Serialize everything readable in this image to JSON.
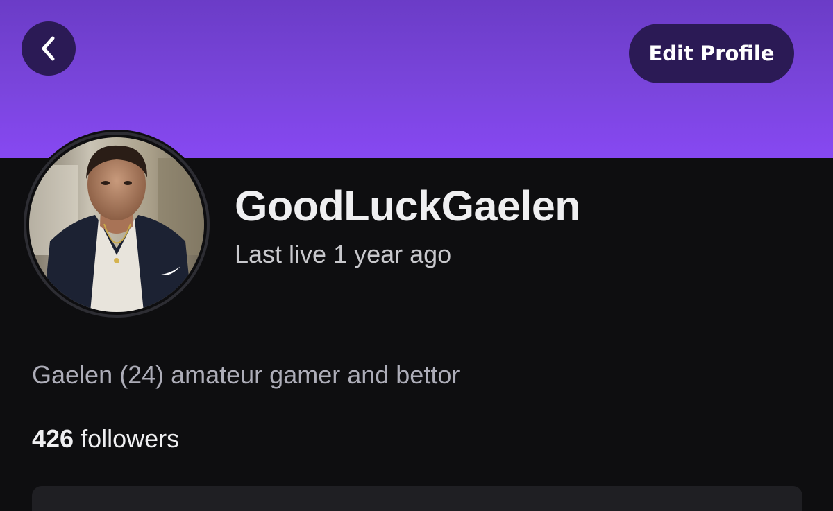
{
  "header": {
    "back_icon": "chevron-left-icon",
    "edit_profile_label": "Edit Profile",
    "banner_color": "#7a45dc",
    "button_color": "#2b1a55"
  },
  "profile": {
    "username": "GoodLuckGaelen",
    "last_live": "Last live 1 year ago",
    "bio": "Gaelen (24) amateur gamer and bettor",
    "followers_count": "426",
    "followers_label": " followers"
  }
}
